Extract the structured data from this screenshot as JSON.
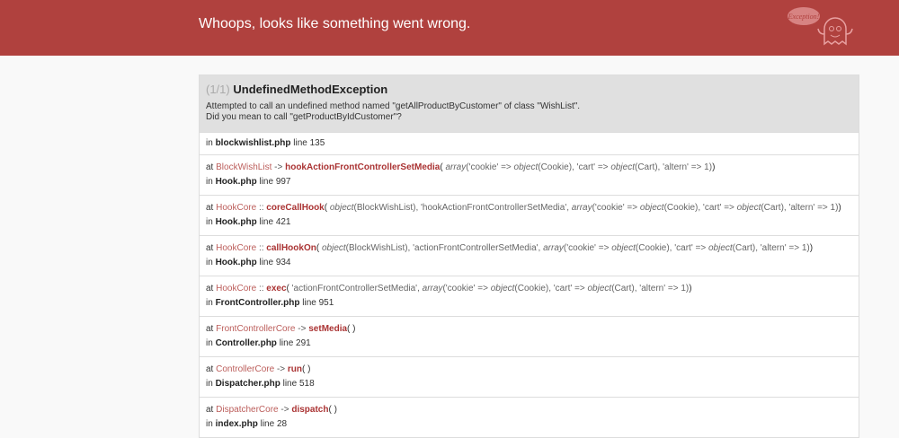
{
  "header": {
    "title": "Whoops, looks like something went wrong.",
    "logo_text": "Exception!"
  },
  "exception": {
    "counter": "(1/1)",
    "name": "UndefinedMethodException",
    "message_line1": "Attempted to call an undefined method named \"getAllProductByCustomer\" of class \"WishList\".",
    "message_line2": "Did you mean to call \"getProductByIdCustomer\"?"
  },
  "origin": {
    "in": "in",
    "file": "blockwishlist.php",
    "line": "line 135"
  },
  "trace": [
    {
      "at": "at",
      "cls": "BlockWishList",
      "type": "->",
      "fn": "hookActionFrontControllerSetMedia",
      "args": "<i>array</i>('cookie' => <i>object</i>(Cookie), 'cart' => <i>object</i>(Cart), 'altern' => 1)",
      "in": "in",
      "file": "Hook.php",
      "line": "line 997"
    },
    {
      "at": "at",
      "cls": "HookCore",
      "type": "::",
      "fn": "coreCallHook",
      "args": "<i>object</i>(BlockWishList), 'hookActionFrontControllerSetMedia', <i>array</i>('cookie' => <i>object</i>(Cookie), 'cart' => <i>object</i>(Cart), 'altern' => 1)",
      "in": "in",
      "file": "Hook.php",
      "line": "line 421"
    },
    {
      "at": "at",
      "cls": "HookCore",
      "type": "::",
      "fn": "callHookOn",
      "args": "<i>object</i>(BlockWishList), 'actionFrontControllerSetMedia', <i>array</i>('cookie' => <i>object</i>(Cookie), 'cart' => <i>object</i>(Cart), 'altern' => 1)",
      "in": "in",
      "file": "Hook.php",
      "line": "line 934"
    },
    {
      "at": "at",
      "cls": "HookCore",
      "type": "::",
      "fn": "exec",
      "args": "'actionFrontControllerSetMedia', <i>array</i>('cookie' => <i>object</i>(Cookie), 'cart' => <i>object</i>(Cart), 'altern' => 1)",
      "in": "in",
      "file": "FrontController.php",
      "line": "line 951"
    },
    {
      "at": "at",
      "cls": "FrontControllerCore",
      "type": "->",
      "fn": "setMedia",
      "args": "",
      "in": "in",
      "file": "Controller.php",
      "line": "line 291"
    },
    {
      "at": "at",
      "cls": "ControllerCore",
      "type": "->",
      "fn": "run",
      "args": "",
      "in": "in",
      "file": "Dispatcher.php",
      "line": "line 518"
    },
    {
      "at": "at",
      "cls": "DispatcherCore",
      "type": "->",
      "fn": "dispatch",
      "args": "",
      "in": "in",
      "file": "index.php",
      "line": "line 28"
    }
  ]
}
